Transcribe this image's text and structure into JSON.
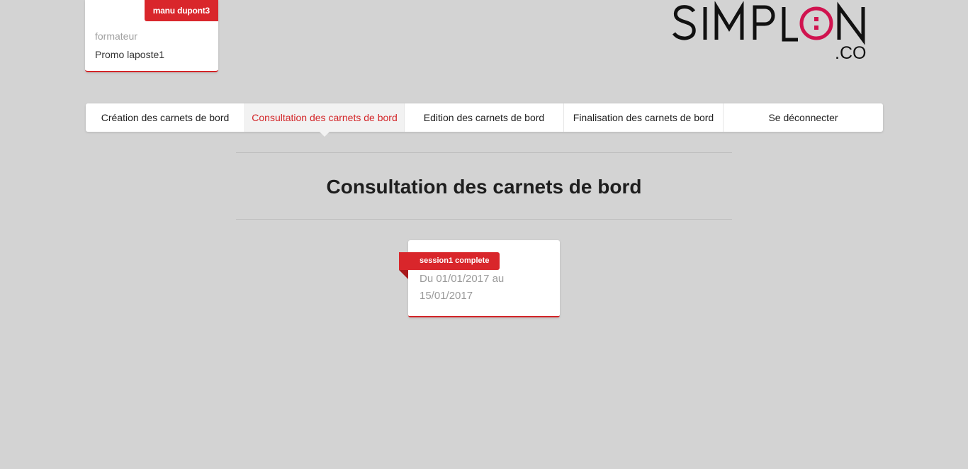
{
  "user": {
    "name": "manu dupont3",
    "role": "formateur",
    "promo": "Promo laposte1"
  },
  "logo": {
    "brand": "SIMPLON",
    "suffix": ".CO",
    "accent_color": "#d0134f"
  },
  "nav": {
    "items": [
      {
        "label": "Création des carnets de bord",
        "active": false
      },
      {
        "label": "Consultation des carnets de bord",
        "active": true
      },
      {
        "label": "Edition des carnets de bord",
        "active": false
      },
      {
        "label": "Finalisation des carnets de bord",
        "active": false
      },
      {
        "label": "Se déconnecter",
        "active": false
      }
    ]
  },
  "main": {
    "title": "Consultation des carnets de bord",
    "sessions": [
      {
        "name": "session1 complete",
        "dates": "Du 01/01/2017 au 15/01/2017"
      }
    ]
  },
  "colors": {
    "accent_red": "#d9262b",
    "background": "#d3d3d3"
  }
}
